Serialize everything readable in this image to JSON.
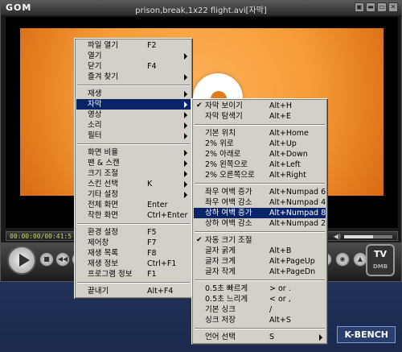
{
  "window": {
    "logo": "GOM",
    "title": "prison,break,1x22 flight.avi[자막]",
    "buttons": [
      "▣",
      "▬",
      "▭",
      "✕"
    ]
  },
  "status": {
    "time": "00:00:00/00:41:5",
    "vol_icon": "◀)",
    "volume_level": 0.6
  },
  "controls": {
    "buttons": [
      "■",
      "◀◀",
      "▮▮",
      "▶▶",
      "♫",
      "⚙",
      "≡",
      "◉",
      "▲"
    ],
    "tv_label": "TV",
    "tv_sub": "DMB"
  },
  "brand": "K-BENCH",
  "main_menu": [
    {
      "label": "파일 열기",
      "shortcut": "F2"
    },
    {
      "label": "열기",
      "shortcut": "",
      "arrow": true
    },
    {
      "label": "닫기",
      "shortcut": "F4"
    },
    {
      "label": "즐겨 찾기",
      "shortcut": "",
      "arrow": true
    },
    {
      "sep": true
    },
    {
      "label": "재생",
      "shortcut": "",
      "arrow": true
    },
    {
      "label": "자막",
      "shortcut": "",
      "arrow": true,
      "highlight": true
    },
    {
      "label": "영상",
      "shortcut": "",
      "arrow": true
    },
    {
      "label": "소리",
      "shortcut": "",
      "arrow": true
    },
    {
      "label": "필터",
      "shortcut": "",
      "arrow": true
    },
    {
      "sep": true
    },
    {
      "label": "화면 비율",
      "shortcut": "",
      "arrow": true
    },
    {
      "label": "팬 & 스캔",
      "shortcut": "",
      "arrow": true
    },
    {
      "label": "크기 조절",
      "shortcut": "",
      "arrow": true
    },
    {
      "label": "스킨 선택",
      "shortcut": "K",
      "arrow": true
    },
    {
      "label": "기타 설정",
      "shortcut": "",
      "arrow": true
    },
    {
      "label": "전체 화면",
      "shortcut": "Enter"
    },
    {
      "label": "작한 화면",
      "shortcut": "Ctrl+Enter"
    },
    {
      "sep": true
    },
    {
      "label": "환경 설정",
      "shortcut": "F5"
    },
    {
      "label": "제어창",
      "shortcut": "F7"
    },
    {
      "label": "재생 목록",
      "shortcut": "F8"
    },
    {
      "label": "재생 정보",
      "shortcut": "Ctrl+F1"
    },
    {
      "label": "프로그램 정보",
      "shortcut": "F1"
    },
    {
      "sep": true
    },
    {
      "label": "끝내기",
      "shortcut": "Alt+F4"
    }
  ],
  "sub_menu": [
    {
      "label": "자막 보이기",
      "shortcut": "Alt+H",
      "checked": true
    },
    {
      "label": "자막 탐색기",
      "shortcut": "Alt+E"
    },
    {
      "sep": true
    },
    {
      "label": "기본 위치",
      "shortcut": "Alt+Home"
    },
    {
      "label": "2% 위로",
      "shortcut": "Alt+Up"
    },
    {
      "label": "2% 아래로",
      "shortcut": "Alt+Down"
    },
    {
      "label": "2% 왼쪽으로",
      "shortcut": "Alt+Left"
    },
    {
      "label": "2% 오른쪽으로",
      "shortcut": "Alt+Right"
    },
    {
      "sep": true
    },
    {
      "label": "좌우 여백 증가",
      "shortcut": "Alt+Numpad 6"
    },
    {
      "label": "좌우 여백 감소",
      "shortcut": "Alt+Numpad 4"
    },
    {
      "label": "상하 여백 증가",
      "shortcut": "Alt+Numpad 8",
      "highlight": true
    },
    {
      "label": "상하 여백 감소",
      "shortcut": "Alt+Numpad 2"
    },
    {
      "sep": true
    },
    {
      "label": "자동 크기 조절",
      "shortcut": "",
      "checked": true
    },
    {
      "label": "글자 굵게",
      "shortcut": "Alt+B"
    },
    {
      "label": "글자 크게",
      "shortcut": "Alt+PageUp"
    },
    {
      "label": "글자 작게",
      "shortcut": "Alt+PageDn"
    },
    {
      "sep": true
    },
    {
      "label": "0.5초 빠르게",
      "shortcut": "> or ."
    },
    {
      "label": "0.5초 느리게",
      "shortcut": "< or ,"
    },
    {
      "label": "기본 싱크",
      "shortcut": "/"
    },
    {
      "label": "싱크 저장",
      "shortcut": "Alt+S"
    },
    {
      "sep": true
    },
    {
      "label": "언어 선택",
      "shortcut": "S",
      "arrow": true
    }
  ]
}
